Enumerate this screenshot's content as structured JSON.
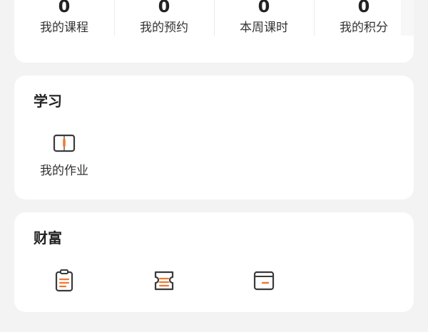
{
  "stats": [
    {
      "value": "0",
      "label": "我的课程"
    },
    {
      "value": "0",
      "label": "我的预约"
    },
    {
      "value": "0",
      "label": "本周课时"
    },
    {
      "value": "0",
      "label": "我的积分"
    }
  ],
  "study": {
    "title": "学习",
    "items": [
      {
        "label": "我的作业",
        "icon": "open-book-icon"
      }
    ]
  },
  "wealth": {
    "title": "财富",
    "items": [
      {
        "icon": "clipboard-icon"
      },
      {
        "icon": "ticket-icon"
      },
      {
        "icon": "card-window-icon"
      }
    ]
  },
  "colors": {
    "accent": "#f07a32",
    "icon_stroke": "#3a3a3a",
    "background": "#f3f3f3",
    "card": "#ffffff"
  }
}
